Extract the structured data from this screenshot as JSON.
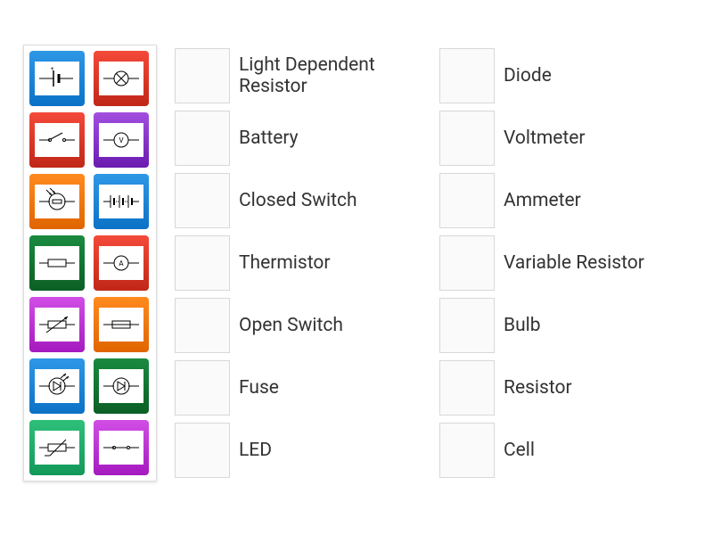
{
  "palette": [
    {
      "id": "cell",
      "color": "c-blue",
      "icon": "cell-symbol-icon"
    },
    {
      "id": "bulb",
      "color": "c-red",
      "icon": "bulb-symbol-icon"
    },
    {
      "id": "open-switch",
      "color": "c-red",
      "icon": "open-switch-symbol-icon"
    },
    {
      "id": "voltmeter",
      "color": "c-purple",
      "icon": "voltmeter-symbol-icon"
    },
    {
      "id": "ldr",
      "color": "c-orange",
      "icon": "ldr-symbol-icon"
    },
    {
      "id": "battery",
      "color": "c-blue",
      "icon": "battery-symbol-icon"
    },
    {
      "id": "resistor",
      "color": "c-green",
      "icon": "resistor-symbol-icon"
    },
    {
      "id": "ammeter",
      "color": "c-red",
      "icon": "ammeter-symbol-icon"
    },
    {
      "id": "variable-res",
      "color": "c-magenta",
      "icon": "variable-resistor-symbol-icon"
    },
    {
      "id": "fuse",
      "color": "c-orange",
      "icon": "fuse-symbol-icon"
    },
    {
      "id": "led",
      "color": "c-blue",
      "icon": "led-symbol-icon"
    },
    {
      "id": "diode",
      "color": "c-green",
      "icon": "diode-symbol-icon"
    },
    {
      "id": "thermistor",
      "color": "c-ltgreen",
      "icon": "thermistor-symbol-icon"
    },
    {
      "id": "closed-switch",
      "color": "c-magenta",
      "icon": "closed-switch-symbol-icon"
    }
  ],
  "answers": {
    "col1": [
      {
        "key": "ldr",
        "label": "Light Dependent Resistor"
      },
      {
        "key": "battery",
        "label": "Battery"
      },
      {
        "key": "closed-switch",
        "label": "Closed Switch"
      },
      {
        "key": "thermistor",
        "label": "Thermistor"
      },
      {
        "key": "open-switch",
        "label": "Open Switch"
      },
      {
        "key": "fuse",
        "label": "Fuse"
      },
      {
        "key": "led",
        "label": "LED"
      }
    ],
    "col2": [
      {
        "key": "diode",
        "label": "Diode"
      },
      {
        "key": "voltmeter",
        "label": "Voltmeter"
      },
      {
        "key": "ammeter",
        "label": "Ammeter"
      },
      {
        "key": "variable-res",
        "label": "Variable Resistor"
      },
      {
        "key": "bulb",
        "label": "Bulb"
      },
      {
        "key": "resistor",
        "label": "Resistor"
      },
      {
        "key": "cell",
        "label": "Cell"
      }
    ]
  },
  "icons": {
    "cell-symbol-icon": "<svg width='44' height='30' viewBox='0 0 44 30'><line x1='2' y1='15' x2='18' y2='15' stroke='#000'/><line x1='18' y1='6' x2='18' y2='24' stroke='#000' stroke-width='1.5'/><line x1='24' y1='10' x2='24' y2='20' stroke='#000' stroke-width='3'/><line x1='24' y1='15' x2='40' y2='15' stroke='#000'/><text x='15' y='6' font-size='6'>+</text></svg>",
    "bulb-symbol-icon": "<svg width='44' height='30' viewBox='0 0 44 30'><line x1='2' y1='15' x2='14' y2='15' stroke='#000'/><circle cx='22' cy='15' r='8' fill='none' stroke='#000'/><line x1='16' y1='9' x2='28' y2='21' stroke='#000'/><line x1='28' y1='9' x2='16' y2='21' stroke='#000'/><line x1='30' y1='15' x2='42' y2='15' stroke='#000'/></svg>",
    "open-switch-symbol-icon": "<svg width='44' height='30' viewBox='0 0 44 30'><line x1='2' y1='15' x2='14' y2='15' stroke='#000'/><circle cx='14' cy='15' r='1.5' fill='none' stroke='#000'/><line x1='15' y1='14' x2='28' y2='7' stroke='#000'/><circle cx='30' cy='15' r='1.5' fill='none' stroke='#000'/><line x1='31' y1='15' x2='42' y2='15' stroke='#000'/></svg>",
    "voltmeter-symbol-icon": "<svg width='44' height='30' viewBox='0 0 44 30'><line x1='2' y1='15' x2='14' y2='15' stroke='#000'/><circle cx='22' cy='15' r='8' fill='none' stroke='#000'/><text x='22' y='18' font-size='8' text-anchor='middle' fill='#000'>V</text><line x1='30' y1='15' x2='42' y2='15' stroke='#000'/></svg>",
    "ldr-symbol-icon": "<svg width='44' height='30' viewBox='0 0 44 30'><line x1='2' y1='15' x2='14' y2='15' stroke='#000'/><circle cx='22' cy='15' r='9' fill='none' stroke='#000'/><rect x='17' y='13' width='10' height='4' fill='none' stroke='#000'/><line x1='30' y1='15' x2='42' y2='15' stroke='#000'/><line x1='10' y1='2' x2='16' y2='8' stroke='#000'/><polygon points='16,8 13,7 15,5' fill='#000'/><line x1='14' y1='0' x2='20' y2='6' stroke='#000'/><polygon points='20,6 17,5 19,3' fill='#000'/></svg>",
    "battery-symbol-icon": "<svg width='44' height='30' viewBox='0 0 44 30'><line x1='2' y1='15' x2='10' y2='15' stroke='#000'/><line x1='10' y1='8' x2='10' y2='22' stroke='#000'/><line x1='14' y1='11' x2='14' y2='19' stroke='#000' stroke-width='2'/><line x1='14' y1='15' x2='20' y2='15' stroke='#000' stroke-dasharray='1,1'/><line x1='20' y1='8' x2='20' y2='22' stroke='#000'/><line x1='24' y1='11' x2='24' y2='19' stroke='#000' stroke-width='2'/><line x1='24' y1='15' x2='30' y2='15' stroke='#000' stroke-dasharray='1,1'/><line x1='30' y1='8' x2='30' y2='22' stroke='#000'/><line x1='34' y1='11' x2='34' y2='19' stroke='#000' stroke-width='2'/><line x1='34' y1='15' x2='42' y2='15' stroke='#000'/></svg>",
    "resistor-symbol-icon": "<svg width='44' height='30' viewBox='0 0 44 30'><line x1='2' y1='15' x2='12' y2='15' stroke='#000'/><rect x='12' y='11' width='20' height='8' fill='none' stroke='#000'/><line x1='32' y1='15' x2='42' y2='15' stroke='#000'/></svg>",
    "ammeter-symbol-icon": "<svg width='44' height='30' viewBox='0 0 44 30'><line x1='2' y1='15' x2='14' y2='15' stroke='#000'/><circle cx='22' cy='15' r='8' fill='none' stroke='#000'/><text x='22' y='18' font-size='8' text-anchor='middle' fill='#000'>A</text><line x1='30' y1='15' x2='42' y2='15' stroke='#000'/></svg>",
    "variable-resistor-symbol-icon": "<svg width='44' height='30' viewBox='0 0 44 30'><line x1='2' y1='15' x2='12' y2='15' stroke='#000'/><rect x='12' y='11' width='20' height='8' fill='none' stroke='#000'/><line x1='32' y1='15' x2='42' y2='15' stroke='#000'/><line x1='10' y1='24' x2='34' y2='6' stroke='#000'/><polygon points='34,6 30,7 32,10' fill='#000'/></svg>",
    "fuse-symbol-icon": "<svg width='44' height='30' viewBox='0 0 44 30'><line x1='2' y1='15' x2='12' y2='15' stroke='#000'/><rect x='12' y='11' width='20' height='8' fill='none' stroke='#000'/><line x1='12' y1='15' x2='32' y2='15' stroke='#000'/><line x1='32' y1='15' x2='42' y2='15' stroke='#000'/></svg>",
    "led-symbol-icon": "<svg width='44' height='30' viewBox='0 0 44 30'><line x1='2' y1='15' x2='14' y2='15' stroke='#000'/><circle cx='22' cy='15' r='9' fill='none' stroke='#000'/><polygon points='18,10 18,20 26,15' fill='none' stroke='#000'/><line x1='26' y1='10' x2='26' y2='20' stroke='#000'/><line x1='30' y1='15' x2='42' y2='15' stroke='#000'/><line x1='26' y1='6' x2='32' y2='1' stroke='#000'/><polygon points='32,1 29,2 31,4' fill='#000'/><line x1='29' y1='9' x2='35' y2='4' stroke='#000'/><polygon points='35,4 32,5 34,7' fill='#000'/></svg>",
    "diode-symbol-icon": "<svg width='44' height='30' viewBox='0 0 44 30'><line x1='2' y1='15' x2='14' y2='15' stroke='#000'/><circle cx='22' cy='15' r='9' fill='none' stroke='#000'/><polygon points='18,10 18,20 26,15' fill='none' stroke='#000'/><line x1='26' y1='10' x2='26' y2='20' stroke='#000'/><line x1='30' y1='15' x2='42' y2='15' stroke='#000'/></svg>",
    "thermistor-symbol-icon": "<svg width='44' height='30' viewBox='0 0 44 30'><line x1='2' y1='15' x2='12' y2='15' stroke='#000'/><rect x='12' y='11' width='20' height='8' fill='none' stroke='#000'/><line x1='32' y1='15' x2='42' y2='15' stroke='#000'/><line x1='8' y1='24' x2='14' y2='24' stroke='#000'/><line x1='14' y1='24' x2='32' y2='6' stroke='#000'/></svg>",
    "closed-switch-symbol-icon": "<svg width='44' height='30' viewBox='0 0 44 30'><line x1='2' y1='15' x2='14' y2='15' stroke='#000'/><circle cx='14' cy='15' r='1.5' fill='none' stroke='#000'/><line x1='15' y1='15' x2='29' y2='15' stroke='#000'/><circle cx='30' cy='15' r='1.5' fill='none' stroke='#000'/><line x1='31' y1='15' x2='42' y2='15' stroke='#000'/></svg>"
  }
}
